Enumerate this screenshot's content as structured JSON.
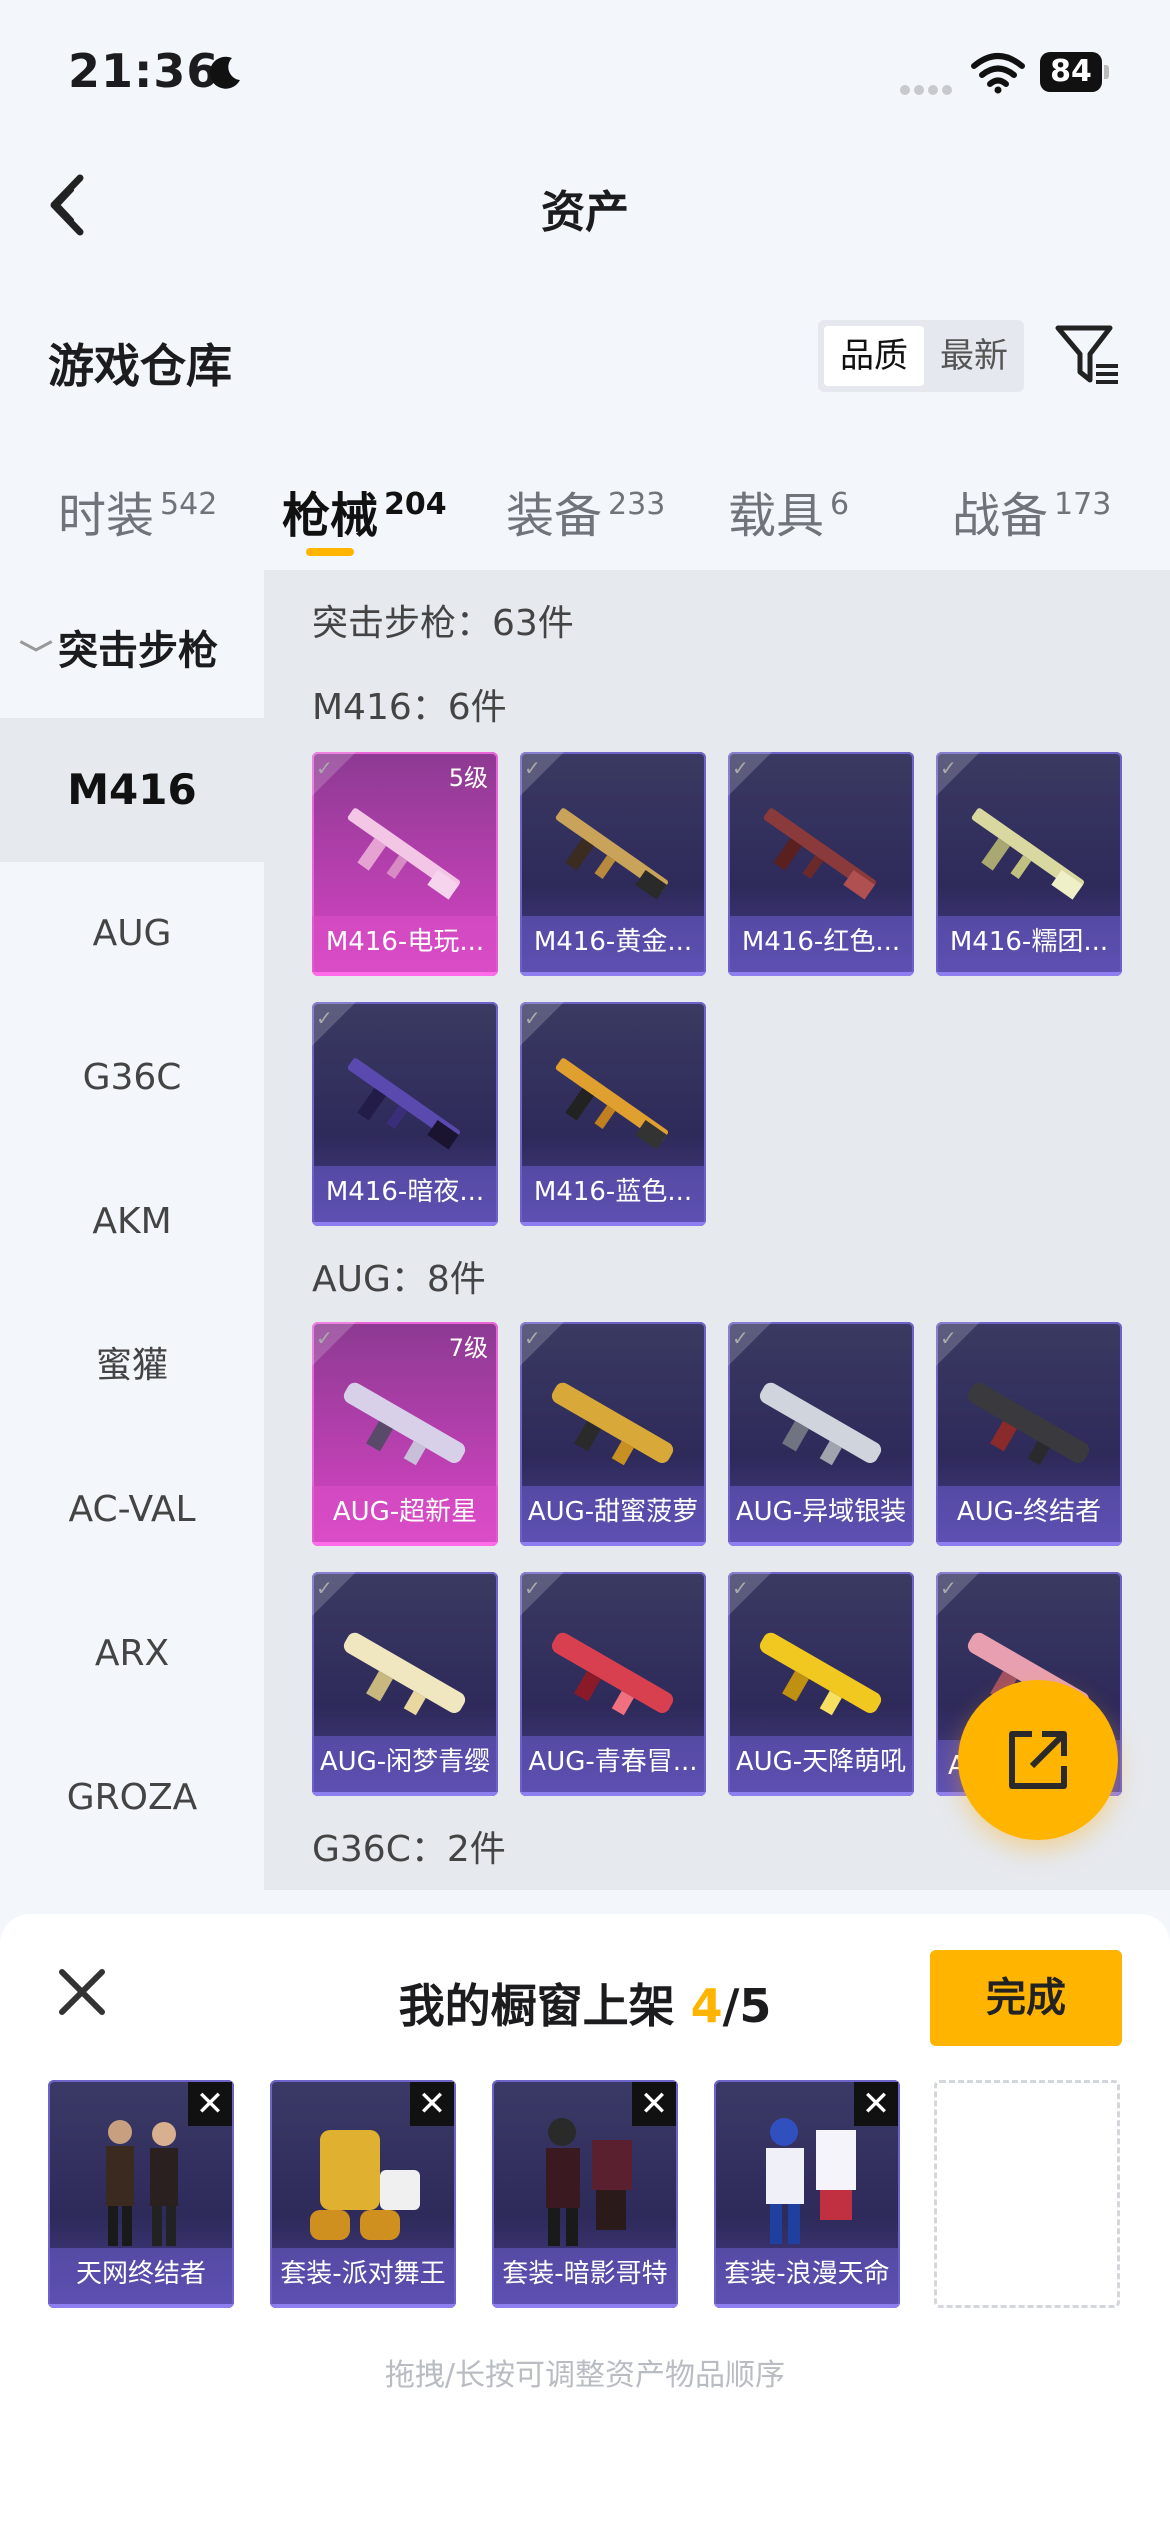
{
  "status_bar": {
    "time": "21:36",
    "battery": "84"
  },
  "header": {
    "title": "资产"
  },
  "warehouse": {
    "title": "游戏仓库",
    "sort_options": [
      "品质",
      "最新"
    ]
  },
  "tabs": [
    {
      "label": "时装",
      "count": "542"
    },
    {
      "label": "枪械",
      "count": "204"
    },
    {
      "label": "装备",
      "count": "233"
    },
    {
      "label": "载具",
      "count": "6"
    },
    {
      "label": "战备",
      "count": "173"
    }
  ],
  "sidebar": {
    "group": "突击步枪",
    "items": [
      "M416",
      "AUG",
      "G36C",
      "AKM",
      "蜜獾",
      "AC-VAL",
      "ARX",
      "GROZA"
    ],
    "active": "M416"
  },
  "content": {
    "category_total": "突击步枪：63件",
    "sections": [
      {
        "label": "M416：6件",
        "items": [
          {
            "name": "M416-电玩...",
            "level": "5级",
            "rarity": "pink"
          },
          {
            "name": "M416-黄金...",
            "rarity": "purple"
          },
          {
            "name": "M416-红色...",
            "rarity": "purple"
          },
          {
            "name": "M416-糯团...",
            "rarity": "purple"
          },
          {
            "name": "M416-暗夜...",
            "rarity": "purple"
          },
          {
            "name": "M416-蓝色...",
            "rarity": "purple"
          }
        ]
      },
      {
        "label": "AUG：8件",
        "items": [
          {
            "name": "AUG-超新星",
            "level": "7级",
            "rarity": "pink"
          },
          {
            "name": "AUG-甜蜜菠萝",
            "rarity": "purple"
          },
          {
            "name": "AUG-异域银装",
            "rarity": "purple"
          },
          {
            "name": "AUG-终结者",
            "rarity": "purple"
          },
          {
            "name": "AUG-闲梦青缨",
            "rarity": "purple"
          },
          {
            "name": "AUG-青春冒...",
            "rarity": "purple"
          },
          {
            "name": "AUG-天降萌吼",
            "rarity": "purple"
          },
          {
            "name": "A",
            "rarity": "purple"
          }
        ]
      },
      {
        "label": "G36C：2件",
        "items": []
      }
    ]
  },
  "showcase": {
    "title": "我的橱窗上架",
    "count_current": "4",
    "count_total": "/5",
    "done_label": "完成",
    "slots": [
      {
        "name": "天网终结者"
      },
      {
        "name": "套装-派对舞王"
      },
      {
        "name": "套装-暗影哥特"
      },
      {
        "name": "套装-浪漫天命"
      }
    ],
    "hint": "拖拽/长按可调整资产物品顺序"
  },
  "colors": {
    "accent": "#ffb400",
    "card_purple": "#2e2a5a",
    "card_pink": "#c241b6"
  }
}
